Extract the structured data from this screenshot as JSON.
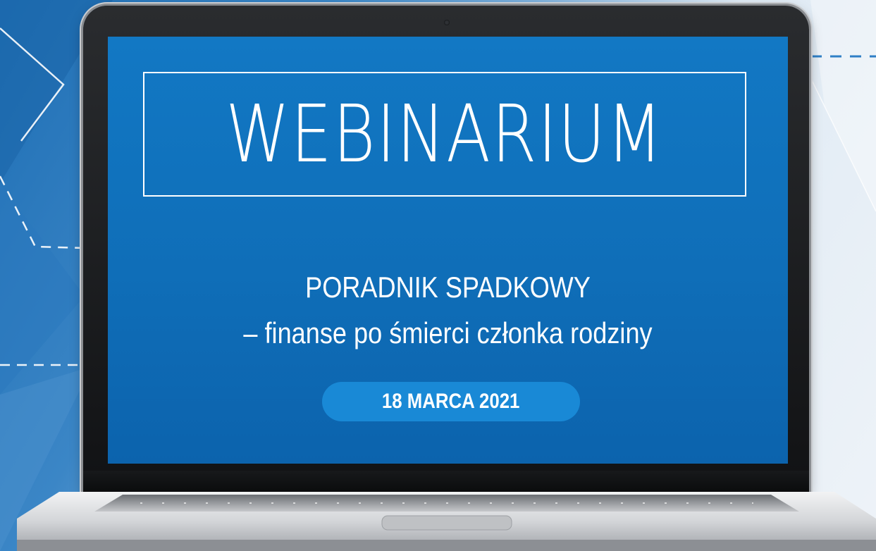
{
  "screen": {
    "title": "WEBINARIUM",
    "subtitle_line1": "PORADNIK SPADKOWY",
    "subtitle_line2": "– finanse po śmierci członka rodziny",
    "date": "18 MARCA 2021"
  },
  "colors": {
    "screen_blue": "#1278c4",
    "pill_blue": "#1989d6",
    "text_white": "#ffffff",
    "laptop_bezel": "#111214",
    "laptop_silver": "#d7d9dc"
  },
  "icons": {
    "camera": "webcam-dot"
  }
}
